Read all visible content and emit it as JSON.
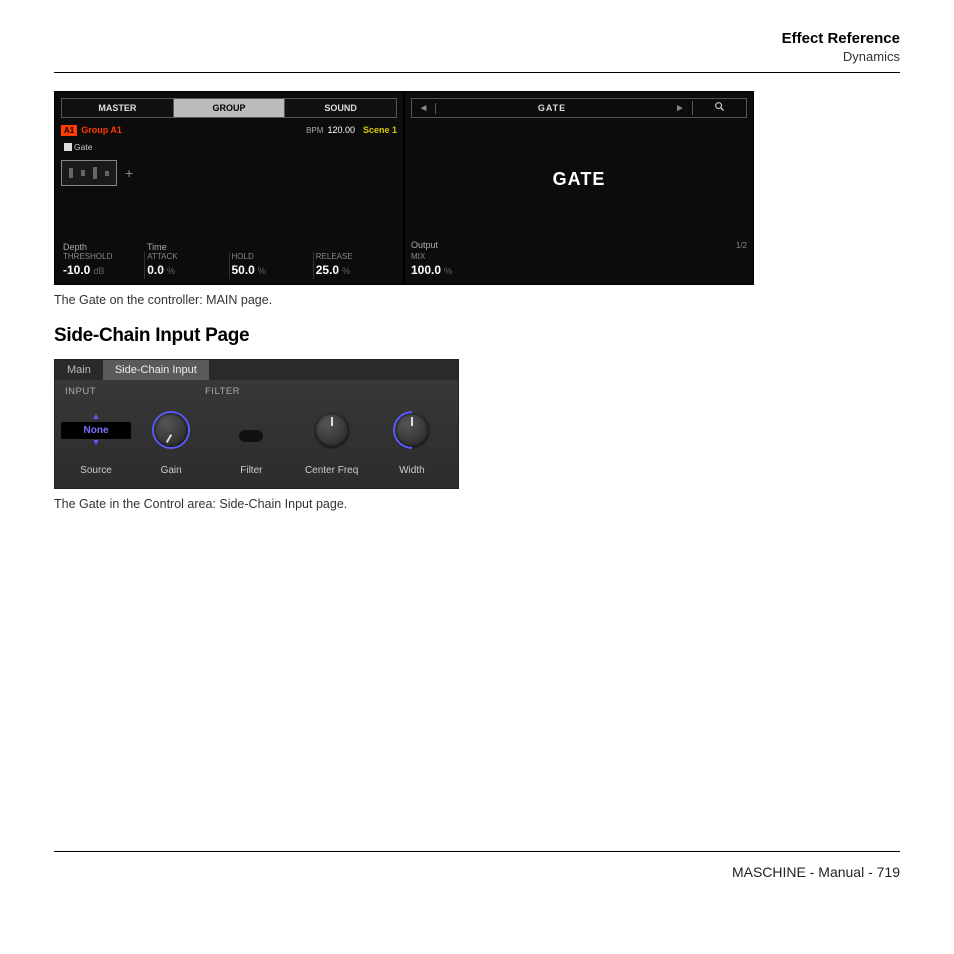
{
  "header": {
    "title": "Effect Reference",
    "sub": "Dynamics"
  },
  "controller": {
    "left": {
      "tabs": [
        "MASTER",
        "GROUP",
        "SOUND"
      ],
      "active_tab": 1,
      "group_badge": "A1",
      "group_name": "Group A1",
      "bpm_label": "BPM",
      "bpm_value": "120.00",
      "scene": "Scene 1",
      "slot_label": "Gate",
      "row_top": [
        "Depth",
        "Time",
        "",
        ""
      ],
      "param_labels": [
        "THRESHOLD",
        "ATTACK",
        "HOLD",
        "RELEASE"
      ],
      "param_values": [
        "-10.0",
        "0.0",
        "50.0",
        "25.0"
      ],
      "param_units": [
        "dB",
        "%",
        "%",
        "%"
      ]
    },
    "right": {
      "nav_title": "GATE",
      "big_label": "GATE",
      "output_label": "Output",
      "page_indicator": "1/2",
      "mix_label": "MIX",
      "mix_value": "100.0",
      "mix_unit": "%"
    }
  },
  "caption1": "The Gate on the controller: MAIN page.",
  "section_heading": "Side-Chain Input Page",
  "sidechain": {
    "tabs": [
      "Main",
      "Side-Chain Input"
    ],
    "active_tab": 1,
    "header_input": "INPUT",
    "header_filter": "FILTER",
    "none_label": "None",
    "knob_labels": [
      "Source",
      "Gain",
      "Filter",
      "Center Freq",
      "Width"
    ]
  },
  "caption2": "The Gate in the Control area: Side-Chain Input page.",
  "footer": "MASCHINE - Manual - 719"
}
